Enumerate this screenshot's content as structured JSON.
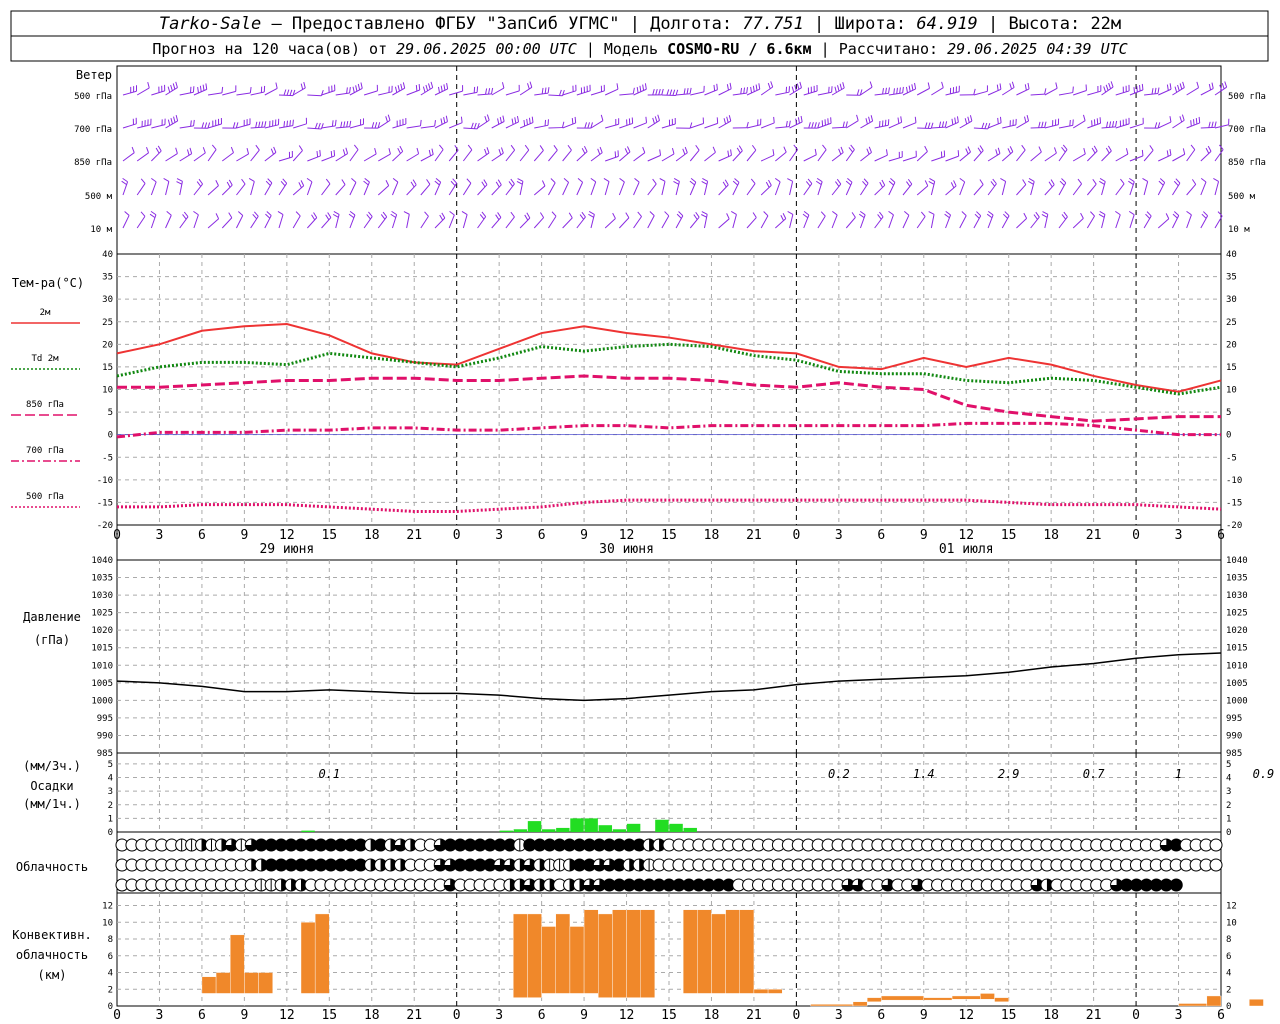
{
  "header": {
    "station": "Tarko-Sale",
    "provider": "Предоставлено ФГБУ \"ЗапСиб УГМС\"",
    "lon_label": "Долгота:",
    "lon": "77.751",
    "lat_label": "Широта:",
    "lat": "64.919",
    "alt_label": "Высота:",
    "alt": "22м",
    "forecast_label": "Прогноз на 120 часа(ов) от",
    "forecast_from": "29.06.2025 00:00 UTC",
    "model_label": "Модель",
    "model": "COSMO-RU / 6.6км",
    "computed_label": "Рассчитано:",
    "computed": "29.06.2025 04:39 UTC"
  },
  "wind_panel": {
    "title": "Ветер",
    "levels": [
      "500 гПа",
      "700 гПа",
      "850 гПа",
      "500 м",
      "10  м"
    ],
    "barb_color": "#8a2be2"
  },
  "temperature": {
    "title": "Тем-ра(°С)",
    "legend": [
      {
        "label": "2м",
        "color": "#ee3333",
        "style": "solid"
      },
      {
        "label": "Td  2м",
        "color": "#118811",
        "style": "dotted"
      },
      {
        "label": "850 гПа",
        "color": "#e0106a",
        "style": "dashed"
      },
      {
        "label": "700 гПа",
        "color": "#e0106a",
        "style": "dashdot"
      },
      {
        "label": "500 гПа",
        "color": "#e0106a",
        "style": "dotted"
      }
    ],
    "yticks": [
      "40",
      "35",
      "30",
      "25",
      "20",
      "15",
      "10",
      "5",
      "0",
      "-5",
      "-10",
      "-15",
      "-20"
    ]
  },
  "pressure": {
    "title": "Давление",
    "unit": "(гПа)",
    "yticks": [
      "1040",
      "1035",
      "1030",
      "1025",
      "1020",
      "1015",
      "1010",
      "1005",
      "1000",
      "995",
      "990",
      "985"
    ]
  },
  "precip": {
    "title": "Осадки",
    "unit3": "(мм/3ч.)",
    "unit1": "(мм/1ч.)",
    "yticks": [
      "5",
      "4",
      "3",
      "2",
      "1",
      "0"
    ],
    "totals": [
      {
        "hour": 15,
        "label": "0.1"
      },
      {
        "hour": 51,
        "label": "0.2"
      },
      {
        "hour": 57,
        "label": "1.4"
      },
      {
        "hour": 63,
        "label": "2.9"
      },
      {
        "hour": 69,
        "label": "0.7"
      },
      {
        "hour": 75,
        "label": "1"
      },
      {
        "hour": 81,
        "label": "0.9"
      }
    ],
    "color": "#22dd22"
  },
  "cloud": {
    "title": "Облачность"
  },
  "convective": {
    "title1": "Конвективн.",
    "title2": "облачность",
    "unit": "(км)",
    "yticks": [
      "12",
      "10",
      "8",
      "6",
      "4",
      "2",
      "0"
    ],
    "color": "#f0882a"
  },
  "x_axis": {
    "tick_labels": [
      "0",
      "3",
      "6",
      "9",
      "12",
      "15",
      "18",
      "21",
      "0",
      "3",
      "6",
      "9",
      "12",
      "15",
      "18",
      "21",
      "0",
      "3",
      "6",
      "9",
      "12",
      "15",
      "18",
      "21",
      "0",
      "3",
      "6"
    ],
    "days": [
      {
        "hour": 12,
        "label": "29 июня"
      },
      {
        "hour": 36,
        "label": "30 июня"
      },
      {
        "hour": 60,
        "label": "01 июля"
      }
    ]
  },
  "chart_data": [
    {
      "type": "line",
      "title": "Тем-ра(°С)",
      "x_hours": [
        0,
        3,
        6,
        9,
        12,
        15,
        18,
        21,
        24,
        27,
        30,
        33,
        36,
        39,
        42,
        45,
        48,
        51,
        54,
        57,
        60,
        63,
        66,
        69,
        72,
        75,
        78
      ],
      "ylim": [
        -20,
        40
      ],
      "series": [
        {
          "name": "2м",
          "values": [
            18,
            20,
            23,
            24,
            24.5,
            22,
            18,
            16,
            15.5,
            19,
            22.5,
            24,
            22.5,
            21.5,
            20,
            18.5,
            18,
            15,
            14.5,
            17,
            15,
            17,
            15.5,
            13,
            11,
            9.5,
            12
          ]
        },
        {
          "name": "Td 2м",
          "values": [
            13,
            15,
            16,
            16,
            15.5,
            18,
            17,
            16,
            15,
            17,
            19.5,
            18.5,
            19.5,
            20,
            19.5,
            17.5,
            16.5,
            14,
            13.5,
            13.5,
            12,
            11.5,
            12.5,
            12,
            10.5,
            9,
            10.5
          ]
        },
        {
          "name": "850 гПа",
          "values": [
            10.5,
            10.5,
            11,
            11.5,
            12,
            12,
            12.5,
            12.5,
            12,
            12,
            12.5,
            13,
            12.5,
            12.5,
            12,
            11,
            10.5,
            11.5,
            10.5,
            10,
            6.5,
            5,
            4,
            3,
            3.5,
            4,
            4
          ]
        },
        {
          "name": "700 гПа",
          "values": [
            -0.5,
            0.5,
            0.5,
            0.5,
            1,
            1,
            1.5,
            1.5,
            1,
            1,
            1.5,
            2,
            2,
            1.5,
            2,
            2,
            2,
            2,
            2,
            2,
            2.5,
            2.5,
            2.5,
            2,
            1,
            0,
            0
          ]
        },
        {
          "name": "500 гПа",
          "values": [
            -16,
            -16,
            -15.5,
            -15.5,
            -15.5,
            -16,
            -16.5,
            -17,
            -17,
            -16.5,
            -16,
            -15,
            -14.5,
            -14.5,
            -14.5,
            -14.5,
            -14.5,
            -14.5,
            -14.5,
            -14.5,
            -14.5,
            -15,
            -15.5,
            -15.5,
            -15.5,
            -16,
            -16.5
          ]
        }
      ]
    },
    {
      "type": "line",
      "title": "Давление",
      "x_hours": [
        0,
        3,
        6,
        9,
        12,
        15,
        18,
        21,
        24,
        27,
        30,
        33,
        36,
        39,
        42,
        45,
        48,
        51,
        54,
        57,
        60,
        63,
        66,
        69,
        72,
        75,
        78
      ],
      "ylim": [
        985,
        1040
      ],
      "series": [
        {
          "name": "Давление",
          "values": [
            1005.5,
            1005,
            1004,
            1002.5,
            1002.5,
            1003,
            1002.5,
            1002,
            1002,
            1001.5,
            1000.5,
            1000,
            1000.5,
            1001.5,
            1002.5,
            1003,
            1004.5,
            1005.5,
            1006,
            1006.5,
            1007,
            1008,
            1009.5,
            1010.5,
            1012,
            1013,
            1013.5
          ]
        }
      ]
    },
    {
      "type": "bar",
      "title": "Осадки",
      "x_hours": [
        13,
        27,
        28,
        29,
        30,
        31,
        32,
        33,
        34,
        35,
        36,
        38,
        39,
        40
      ],
      "ylim": [
        0,
        5
      ],
      "values": [
        0.1,
        0.1,
        0.2,
        0.8,
        0.2,
        0.3,
        1.0,
        1.0,
        0.5,
        0.2,
        0.6,
        0.9,
        0.6,
        0.3
      ]
    },
    {
      "type": "table",
      "title": "Облачность",
      "rows": 3,
      "hours_per_col": 1,
      "levels": [
        [
          0,
          0,
          0,
          0,
          0,
          0,
          1,
          1,
          2,
          1,
          2,
          3,
          1,
          3,
          4,
          4,
          4,
          4,
          4,
          4,
          4,
          4,
          4,
          4,
          4,
          2,
          4,
          2,
          3,
          2,
          0,
          0,
          3,
          4,
          4,
          4,
          4,
          4,
          4,
          4,
          1,
          4,
          4,
          4,
          4,
          4,
          4,
          4,
          4,
          4,
          4,
          4,
          4,
          2,
          2,
          0,
          0,
          0,
          0,
          0,
          0,
          0,
          0,
          0,
          0,
          0,
          0,
          0,
          0,
          0,
          0,
          0,
          0,
          0,
          0,
          0,
          0,
          0,
          0,
          0,
          0,
          0,
          0,
          0,
          0,
          0,
          0,
          0,
          0,
          0,
          0,
          0,
          0,
          0,
          0,
          0,
          0,
          0,
          0,
          0,
          0,
          0,
          0,
          0,
          0,
          3,
          4,
          0,
          0,
          0,
          0
        ],
        [
          0,
          0,
          0,
          0,
          0,
          0,
          0,
          0,
          0,
          0,
          0,
          0,
          0,
          2,
          2,
          4,
          4,
          4,
          4,
          4,
          4,
          4,
          4,
          4,
          4,
          2,
          2,
          2,
          2,
          0,
          0,
          0,
          3,
          3,
          4,
          4,
          4,
          4,
          3,
          3,
          2,
          3,
          2,
          1,
          1,
          2,
          4,
          4,
          3,
          3,
          4,
          2,
          2,
          1,
          0,
          0,
          0,
          0,
          0,
          0,
          0,
          0,
          0,
          0,
          0,
          0,
          0,
          0,
          0,
          0,
          0,
          0,
          0,
          0,
          0,
          0,
          0,
          0,
          0,
          0,
          0,
          0,
          0,
          0,
          0,
          0,
          0,
          0,
          0,
          0,
          0,
          0,
          0,
          0,
          0,
          0,
          0,
          0,
          0,
          0,
          0,
          0,
          0,
          0,
          0,
          0,
          0,
          0,
          0,
          0,
          0
        ],
        [
          0,
          0,
          0,
          0,
          0,
          0,
          0,
          0,
          0,
          0,
          0,
          0,
          0,
          0,
          1,
          1,
          2,
          2,
          2,
          0,
          0,
          0,
          0,
          0,
          0,
          0,
          0,
          0,
          0,
          0,
          0,
          0,
          0,
          3,
          0,
          0,
          0,
          0,
          0,
          2,
          2,
          3,
          2,
          2,
          0,
          2,
          2,
          3,
          3,
          4,
          4,
          4,
          4,
          4,
          4,
          4,
          4,
          4,
          4,
          4,
          4,
          4,
          0,
          0,
          0,
          0,
          0,
          0,
          0,
          0,
          0,
          0,
          0,
          3,
          3,
          0,
          0,
          3,
          0,
          0,
          3,
          0,
          0,
          0,
          0,
          0,
          0,
          0,
          0,
          0,
          0,
          0,
          3,
          2,
          0,
          0,
          0,
          0,
          0,
          0,
          3,
          4,
          4,
          4,
          4,
          4,
          4
        ]
      ]
    },
    {
      "type": "bar",
      "title": "Конвективн. облачность",
      "ylim": [
        0,
        13
      ],
      "segments": [
        {
          "h0": 6,
          "h1": 7,
          "base": 1.5,
          "top": 3.5
        },
        {
          "h0": 7,
          "h1": 8,
          "base": 1.5,
          "top": 4
        },
        {
          "h0": 8,
          "h1": 9,
          "base": 1.5,
          "top": 8.5
        },
        {
          "h0": 9,
          "h1": 10,
          "base": 1.5,
          "top": 4
        },
        {
          "h0": 10,
          "h1": 11,
          "base": 1.5,
          "top": 4
        },
        {
          "h0": 13,
          "h1": 14,
          "base": 1.5,
          "top": 10
        },
        {
          "h0": 14,
          "h1": 15,
          "base": 1.5,
          "top": 11
        },
        {
          "h0": 28,
          "h1": 29,
          "base": 1,
          "top": 11
        },
        {
          "h0": 29,
          "h1": 30,
          "base": 1,
          "top": 11
        },
        {
          "h0": 30,
          "h1": 31,
          "base": 1.5,
          "top": 9.5
        },
        {
          "h0": 31,
          "h1": 32,
          "base": 1.5,
          "top": 11
        },
        {
          "h0": 32,
          "h1": 33,
          "base": 1.5,
          "top": 9.5
        },
        {
          "h0": 33,
          "h1": 34,
          "base": 1.5,
          "top": 11.5
        },
        {
          "h0": 34,
          "h1": 35,
          "base": 1,
          "top": 11
        },
        {
          "h0": 35,
          "h1": 36,
          "base": 1,
          "top": 11.5
        },
        {
          "h0": 36,
          "h1": 37,
          "base": 1,
          "top": 11.5
        },
        {
          "h0": 37,
          "h1": 38,
          "base": 1,
          "top": 11.5
        },
        {
          "h0": 40,
          "h1": 41,
          "base": 1.5,
          "top": 11.5
        },
        {
          "h0": 41,
          "h1": 42,
          "base": 1.5,
          "top": 11.5
        },
        {
          "h0": 42,
          "h1": 43,
          "base": 1.5,
          "top": 11
        },
        {
          "h0": 43,
          "h1": 44,
          "base": 1.5,
          "top": 11.5
        },
        {
          "h0": 44,
          "h1": 45,
          "base": 1.5,
          "top": 11.5
        },
        {
          "h0": 45,
          "h1": 46,
          "base": 1.5,
          "top": 2
        },
        {
          "h0": 46,
          "h1": 47,
          "base": 1.5,
          "top": 2
        },
        {
          "h0": 49,
          "h1": 52,
          "base": 0,
          "top": 0.2
        },
        {
          "h0": 52,
          "h1": 53,
          "base": 0,
          "top": 0.5
        },
        {
          "h0": 53,
          "h1": 54,
          "base": 0.5,
          "top": 1
        },
        {
          "h0": 54,
          "h1": 57,
          "base": 0.7,
          "top": 1.2
        },
        {
          "h0": 57,
          "h1": 59,
          "base": 0.7,
          "top": 1
        },
        {
          "h0": 59,
          "h1": 61,
          "base": 0.8,
          "top": 1.2
        },
        {
          "h0": 61,
          "h1": 62,
          "base": 0.8,
          "top": 1.5
        },
        {
          "h0": 62,
          "h1": 63,
          "base": 0.5,
          "top": 1
        },
        {
          "h0": 75,
          "h1": 77,
          "base": 0,
          "top": 0.3
        },
        {
          "h0": 77,
          "h1": 78,
          "base": 0,
          "top": 1.2
        },
        {
          "h0": 80,
          "h1": 81,
          "base": 0,
          "top": 0.8
        }
      ]
    }
  ]
}
